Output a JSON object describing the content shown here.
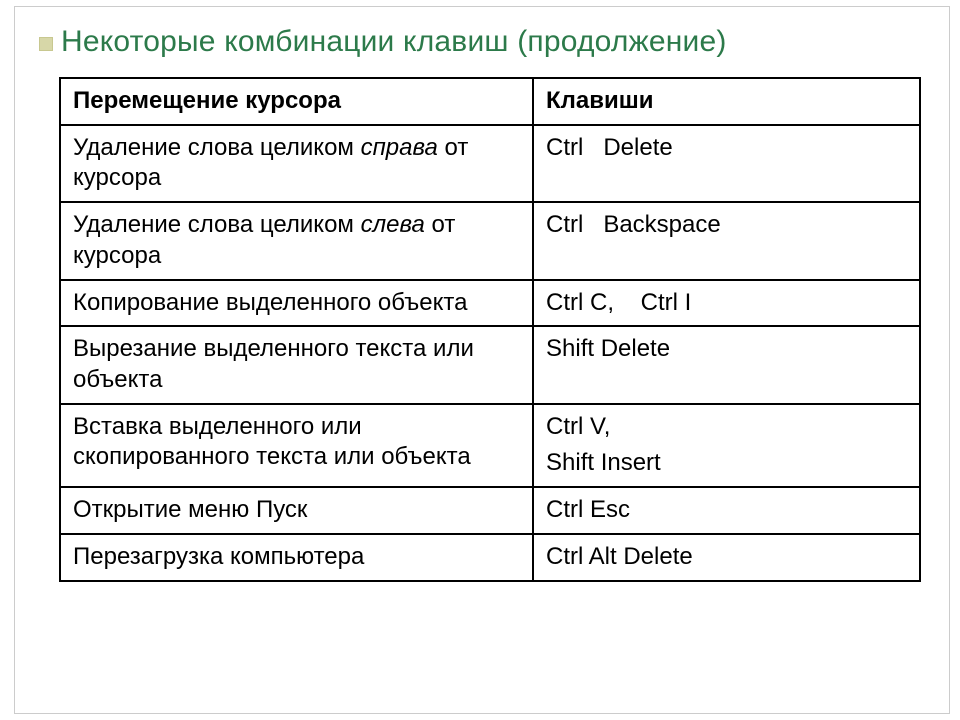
{
  "title": "Некоторые комбинации клавиш (продолжение)",
  "header": {
    "col1": "Перемещение курсора",
    "col2": "Клавиши"
  },
  "rows": [
    {
      "pre": "Удаление слова целиком ",
      "em": "справа",
      "post": " от курсора",
      "keys": "Ctrl   Delete"
    },
    {
      "pre": "Удаление слова целиком ",
      "em": "слева",
      "post": " от курсора",
      "keys": "Ctrl   Backspace"
    },
    {
      "pre": "Копирование выделенного объекта",
      "em": "",
      "post": "",
      "keys": "Ctrl  C,    Ctrl  I"
    },
    {
      "pre": "Вырезание выделенного текста или объекта",
      "em": "",
      "post": "",
      "keys": "Shift  Delete"
    },
    {
      "pre": "Вставка выделенного или скопированного текста или объекта",
      "em": "",
      "post": "",
      "keys": "Ctrl  V,",
      "keys2": "Shift  Insert"
    },
    {
      "pre": "Открытие меню Пуск",
      "em": "",
      "post": "",
      "keys": "Ctrl  Esc"
    },
    {
      "pre": "Перезагрузка компьютера",
      "em": "",
      "post": "",
      "keys": "Ctrl Alt Delete"
    }
  ]
}
